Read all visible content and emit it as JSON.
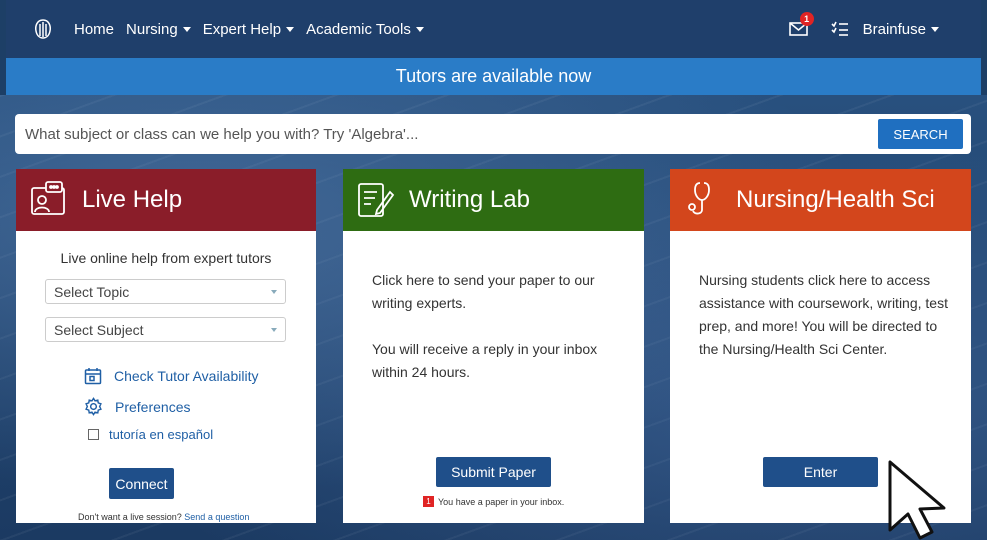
{
  "nav": {
    "items": [
      {
        "label": "Home",
        "dropdown": false
      },
      {
        "label": "Nursing",
        "dropdown": true
      },
      {
        "label": "Expert Help",
        "dropdown": true
      },
      {
        "label": "Academic Tools",
        "dropdown": true
      }
    ],
    "notification_count": "1",
    "user_label": "Brainfuse"
  },
  "banner": "Tutors are available now",
  "search": {
    "placeholder": "What subject or class can we help you with? Try 'Algebra'...",
    "button": "SEARCH"
  },
  "live_help": {
    "title": "Live Help",
    "subtitle": "Live online help from expert tutors",
    "topic_select": "Select Topic",
    "subject_select": "Select Subject",
    "availability_link": "Check Tutor Availability",
    "preferences_link": "Preferences",
    "spanish_label": "tutoría en español",
    "connect_button": "Connect",
    "question_prompt": "Don't want a live session?",
    "question_link": "Send a question"
  },
  "writing_lab": {
    "title": "Writing Lab",
    "desc1": "Click here to send your paper to our writing experts.",
    "desc2": "You will receive a reply in your inbox within 24 hours.",
    "submit_button": "Submit Paper",
    "inbox_count": "1",
    "inbox_note": "You have a paper in your inbox."
  },
  "nursing": {
    "title": "Nursing/Health Sci",
    "desc": "Nursing students click here to access assistance with coursework, writing, test prep, and more! You will be directed to the Nursing/Health Sci Center.",
    "enter_button": "Enter"
  },
  "colors": {
    "navbar": "#1f3f6b",
    "banner": "#2a7cc7",
    "live_help": "#8a1d29",
    "writing_lab": "#2e6c12",
    "nursing": "#d3461c",
    "button": "#1f4f8a"
  }
}
